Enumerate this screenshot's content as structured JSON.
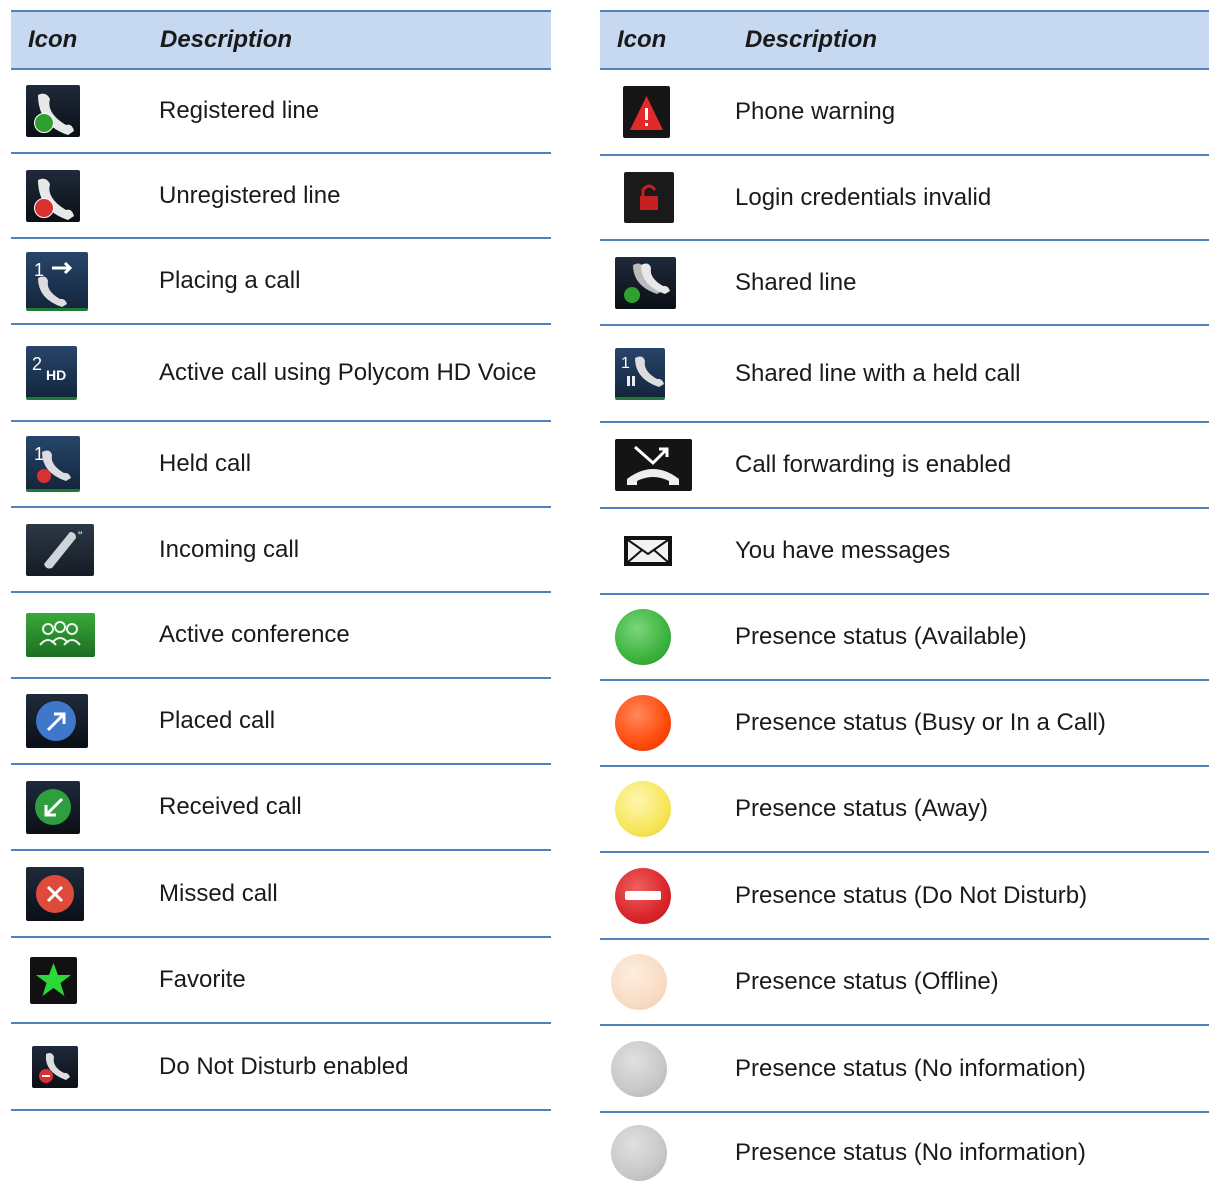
{
  "header": {
    "icon": "Icon",
    "description": "Description"
  },
  "left_rows": [
    {
      "icon": "registered-line-icon",
      "label": "Registered line"
    },
    {
      "icon": "unregistered-line-icon",
      "label": "Unregistered line"
    },
    {
      "icon": "placing-call-icon",
      "label": "Placing a call"
    },
    {
      "icon": "hd-voice-icon",
      "label": "Active call using Polycom HD Voice"
    },
    {
      "icon": "held-call-icon",
      "label": "Held call"
    },
    {
      "icon": "incoming-call-icon",
      "label": "Incoming call"
    },
    {
      "icon": "conference-icon",
      "label": "Active conference"
    },
    {
      "icon": "placed-call-icon",
      "label": "Placed call"
    },
    {
      "icon": "received-call-icon",
      "label": "Received call"
    },
    {
      "icon": "missed-call-icon",
      "label": "Missed call"
    },
    {
      "icon": "favorite-star-icon",
      "label": "Favorite"
    },
    {
      "icon": "dnd-enabled-icon",
      "label": "Do Not Disturb enabled"
    }
  ],
  "right_rows": [
    {
      "icon": "warning-icon",
      "label": "Phone warning"
    },
    {
      "icon": "lock-icon",
      "label": "Login credentials invalid"
    },
    {
      "icon": "shared-line-icon",
      "label": "Shared line"
    },
    {
      "icon": "shared-held-icon",
      "label": "Shared line with a held call"
    },
    {
      "icon": "call-forward-icon",
      "label": "Call forwarding is enabled"
    },
    {
      "icon": "envelope-icon",
      "label": "You have messages"
    },
    {
      "icon": "presence-available-icon",
      "label": "Presence status (Available)",
      "color": "#3db33d"
    },
    {
      "icon": "presence-busy-icon",
      "label": "Presence status (Busy or In a Call)",
      "color": "#ff4a0c"
    },
    {
      "icon": "presence-away-icon",
      "label": "Presence status (Away)",
      "color": "#f7e65a"
    },
    {
      "icon": "presence-dnd-icon",
      "label": "Presence status (Do Not Disturb)",
      "color": "#d9262b"
    },
    {
      "icon": "presence-offline-icon",
      "label": "Presence status (Offline)",
      "color": "#f8dcc4"
    },
    {
      "icon": "presence-noinfo-icon",
      "label": "Presence status (No information)",
      "color": "#c8c8c8"
    },
    {
      "icon": "presence-noinfo-icon",
      "label": "Presence status (No information)",
      "color": "#c8c8c8"
    }
  ]
}
